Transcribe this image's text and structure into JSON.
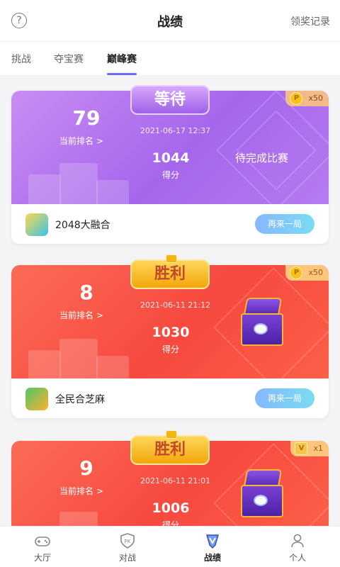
{
  "header": {
    "title": "战绩",
    "help_icon": "question-circle-icon",
    "help_glyph": "?",
    "record_link": "领奖记录"
  },
  "tabs": [
    {
      "label": "挑战",
      "active": false
    },
    {
      "label": "夺宝赛",
      "active": false
    },
    {
      "label": "巅峰赛",
      "active": true
    }
  ],
  "cards": [
    {
      "status": "等待",
      "rank": "79",
      "rank_label": "当前排名",
      "rank_chevron": ">",
      "date": "2021-06-17 12:37",
      "score": "1044",
      "score_label": "得分",
      "result_text": "待完成比赛",
      "reward_count": "x50",
      "reward_icon": "coin-icon",
      "game_name": "2048大融合",
      "game_icon": "game-2048-icon",
      "action_label": "再来一局",
      "theme_color": "#a566ec"
    },
    {
      "status": "胜利",
      "rank": "8",
      "rank_label": "当前排名",
      "rank_chevron": ">",
      "date": "2021-06-11 21:12",
      "score": "1030",
      "score_label": "得分",
      "reward_count": "x50",
      "reward_icon": "coin-icon",
      "game_name": "全民合芝麻",
      "game_icon": "game-fruit-icon",
      "action_label": "再来一局",
      "theme_color": "#f7493f"
    },
    {
      "status": "胜利",
      "rank": "9",
      "rank_label": "当前排名",
      "rank_chevron": ">",
      "date": "2021-06-11 21:01",
      "score": "1006",
      "score_label": "得分",
      "reward_count": "x1",
      "reward_icon": "ticket-icon",
      "theme_color": "#f7493f"
    }
  ],
  "bottom_nav": [
    {
      "label": "大厅",
      "icon": "gamepad-icon",
      "active": false
    },
    {
      "label": "对战",
      "icon": "pk-shield-icon",
      "active": false
    },
    {
      "label": "战绩",
      "icon": "trophy-v-icon",
      "active": true
    },
    {
      "label": "个人",
      "icon": "person-icon",
      "active": false
    }
  ],
  "colors": {
    "accent": "#6b6cf6",
    "purple_card": "#a566ec",
    "red_card": "#f7493f",
    "button_gradient_start": "#86b8ff",
    "button_gradient_end": "#79dcf0"
  }
}
